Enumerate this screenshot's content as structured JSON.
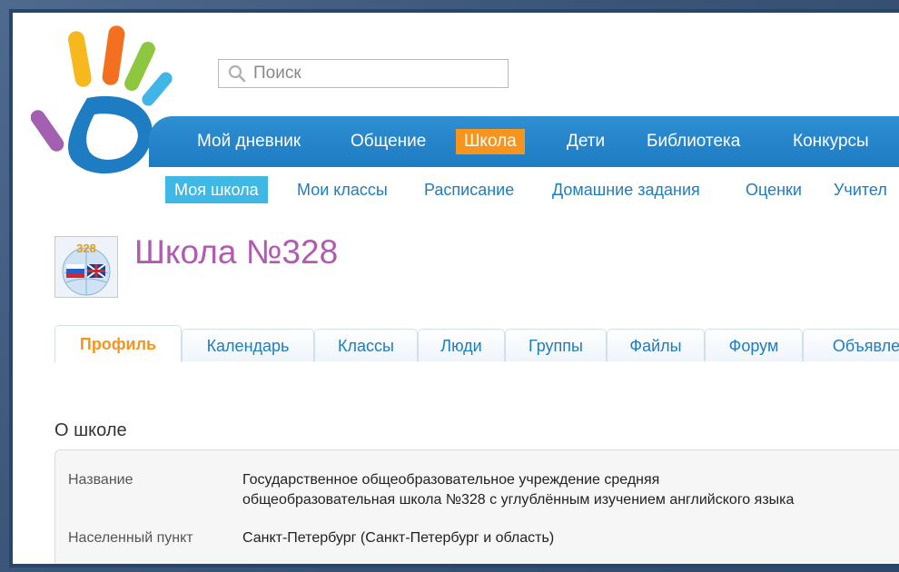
{
  "search": {
    "placeholder": "Поиск"
  },
  "topnav": {
    "items": [
      {
        "label": "Мой дневник"
      },
      {
        "label": "Общение"
      },
      {
        "label": "Школа"
      },
      {
        "label": "Дети"
      },
      {
        "label": "Библиотека"
      },
      {
        "label": "Конкурсы"
      }
    ],
    "active_index": 2
  },
  "subnav": {
    "items": [
      {
        "label": "Моя школа"
      },
      {
        "label": "Мои классы"
      },
      {
        "label": "Расписание"
      },
      {
        "label": "Домашние задания"
      },
      {
        "label": "Оценки"
      },
      {
        "label": "Учител"
      }
    ],
    "active_index": 0
  },
  "school": {
    "title": "Школа №328",
    "logo_text": "328"
  },
  "tabs": {
    "items": [
      {
        "label": "Профиль"
      },
      {
        "label": "Календарь"
      },
      {
        "label": "Классы"
      },
      {
        "label": "Люди"
      },
      {
        "label": "Группы"
      },
      {
        "label": "Файлы"
      },
      {
        "label": "Форум"
      },
      {
        "label": "Объявле"
      }
    ],
    "active_index": 0
  },
  "about": {
    "heading": "О школе",
    "rows": [
      {
        "label": "Название",
        "value_line1": "Государственное общеобразовательное учреждение средняя",
        "value_line2": "общеобразовательная школа №328 с углублённым изучением английского языка"
      },
      {
        "label": "Населенный пункт",
        "value_line1": "Санкт-Петербург (Санкт-Петербург и область)"
      }
    ]
  },
  "colors": {
    "nav_blue": "#1e7cc2",
    "active_orange": "#f7941d",
    "subnav_active": "#3fb8e6",
    "title_purple": "#b05ab2",
    "link_blue": "#1f7cbf"
  },
  "icons": [
    "hand-logo-icon",
    "search-icon",
    "school-emblem-icon"
  ]
}
